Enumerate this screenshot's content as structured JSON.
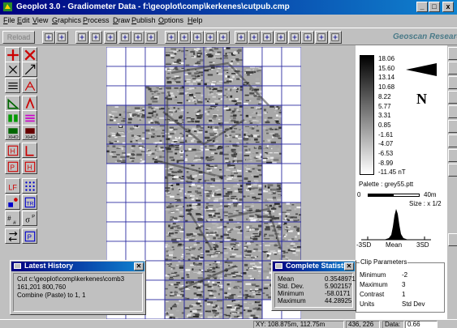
{
  "window": {
    "title": "Geoplot 3.0 - Gradiometer Data - f:\\geoplot\\comp\\kerkenes\\cutpub.cmp",
    "buttons": [
      "_",
      "□",
      "x"
    ]
  },
  "menu": {
    "items": [
      {
        "label": "File",
        "key": "F",
        "rest": "ile"
      },
      {
        "label": "Edit",
        "key": "E",
        "rest": "dit"
      },
      {
        "label": "View",
        "key": "V",
        "rest": "iew"
      },
      {
        "label": "Graphics",
        "key": "G",
        "rest": "raphics"
      },
      {
        "label": "Process",
        "key": "P",
        "rest": "rocess"
      },
      {
        "label": "Draw",
        "key": "D",
        "rest": "raw"
      },
      {
        "label": "Publish",
        "key": "P",
        "rest": "ublish"
      },
      {
        "label": "Options",
        "key": "O",
        "rest": "ptions"
      },
      {
        "label": "Help",
        "key": "H",
        "rest": "elp"
      }
    ]
  },
  "toolbar": {
    "reload_label": "Reload",
    "brand": "Geoscan Research",
    "icons": [
      "open-folder-icon",
      "save-icon",
      "cut-icon",
      "crosshair-icon",
      "hand-pan-icon",
      "zoom-in-icon",
      "zoom-out-icon",
      "zoom-window-icon",
      "shade-icon",
      "contrast-icon",
      "histogram-icon",
      "tile-icon",
      "trace-icon",
      "grid-1-icon",
      "grid-2-icon",
      "grid-3-icon",
      "chart-icon",
      "grid-4-icon",
      "grid-5-icon",
      "palette-icon",
      "camera-icon"
    ]
  },
  "left_palette": {
    "tools": [
      "plus-tool-icon",
      "cross-tool-icon",
      "destripe-icon",
      "despike-icon",
      "clip-icon",
      "interpolate-icon",
      "triangle-tool-icon",
      "lambda-tool-icon",
      "stereo-icon",
      "multiline-icon",
      "ratio-icon",
      "xo-icon",
      "hash-icon",
      "l-bracket-icon",
      "p-tool-icon",
      "h-tool-icon",
      "lf-filter-icon",
      "dots-icon",
      "scatter-icon",
      "tr-tool-icon",
      "subscript-tool-icon",
      "sigma-tool-icon",
      "swap-icon",
      "p-box-icon"
    ]
  },
  "scale": {
    "labels": [
      "18.06",
      "15.60",
      "13.14",
      "10.68",
      "8.22",
      "5.77",
      "3.31",
      "0.85",
      "-1.61",
      "-4.07",
      "-6.53",
      "-8.99",
      "-11.45 nT"
    ],
    "palette_label": "Palette : grey55.ptt",
    "distance_start": "0",
    "distance_end": "40m",
    "size_label": "Size : x 1/2",
    "north_letter": "N",
    "hist_labels": [
      "-3SD",
      "Mean",
      "3SD"
    ]
  },
  "clip_parameters": {
    "title": "Clip Parameters",
    "rows": [
      {
        "label": "Minimum",
        "value": "-2"
      },
      {
        "label": "Maximum",
        "value": "3"
      },
      {
        "label": "Contrast",
        "value": "1"
      },
      {
        "label": "Units",
        "value": "Std Dev"
      }
    ]
  },
  "latest_history": {
    "title": "Latest History",
    "lines": [
      "Cut  c:\\geoplot\\comp\\kerkenes\\comb3",
      "161,201 800,760",
      "Combine (Paste) to 1, 1"
    ]
  },
  "statistics": {
    "title": "Complete Statistics",
    "rows": [
      {
        "label": "Mean",
        "value": "0.3548971"
      },
      {
        "label": "Std. Dev.",
        "value": "5.902157"
      },
      {
        "label": "Minimum",
        "value": "-58.0171"
      },
      {
        "label": "Maximum",
        "value": "44.28925"
      }
    ]
  },
  "status": {
    "xy_label": "XY:",
    "xy_value": "108.875m, 112.75m",
    "pixel_value": "436, 226",
    "data_label": "Data:",
    "data_value": "0.66"
  },
  "survey_grid": {
    "cols": 10,
    "rows": 14,
    "rows_spec": [
      [
        0,
        0,
        0,
        1,
        1,
        1,
        1,
        0,
        0,
        0
      ],
      [
        0,
        0,
        0,
        1,
        1,
        1,
        1,
        1,
        0,
        0
      ],
      [
        0,
        0,
        1,
        1,
        1,
        1,
        1,
        1,
        0,
        0
      ],
      [
        1,
        1,
        1,
        1,
        1,
        1,
        1,
        1,
        1,
        0
      ],
      [
        1,
        1,
        1,
        1,
        1,
        1,
        1,
        1,
        1,
        0
      ],
      [
        1,
        1,
        1,
        1,
        1,
        1,
        1,
        1,
        1,
        0
      ],
      [
        0,
        0,
        0,
        1,
        1,
        1,
        1,
        1,
        0,
        0
      ],
      [
        0,
        0,
        0,
        1,
        1,
        1,
        1,
        1,
        1,
        0
      ],
      [
        0,
        0,
        0,
        1,
        1,
        1,
        1,
        1,
        1,
        1
      ],
      [
        0,
        0,
        0,
        1,
        1,
        1,
        1,
        1,
        1,
        1
      ],
      [
        0,
        0,
        0,
        1,
        1,
        1,
        1,
        1,
        1,
        1
      ],
      [
        0,
        0,
        0,
        1,
        1,
        1,
        1,
        1,
        1,
        1
      ],
      [
        0,
        0,
        0,
        1,
        1,
        1,
        1,
        1,
        1,
        1
      ],
      [
        0,
        0,
        0,
        1,
        1,
        1,
        1,
        1,
        0,
        0
      ]
    ]
  }
}
